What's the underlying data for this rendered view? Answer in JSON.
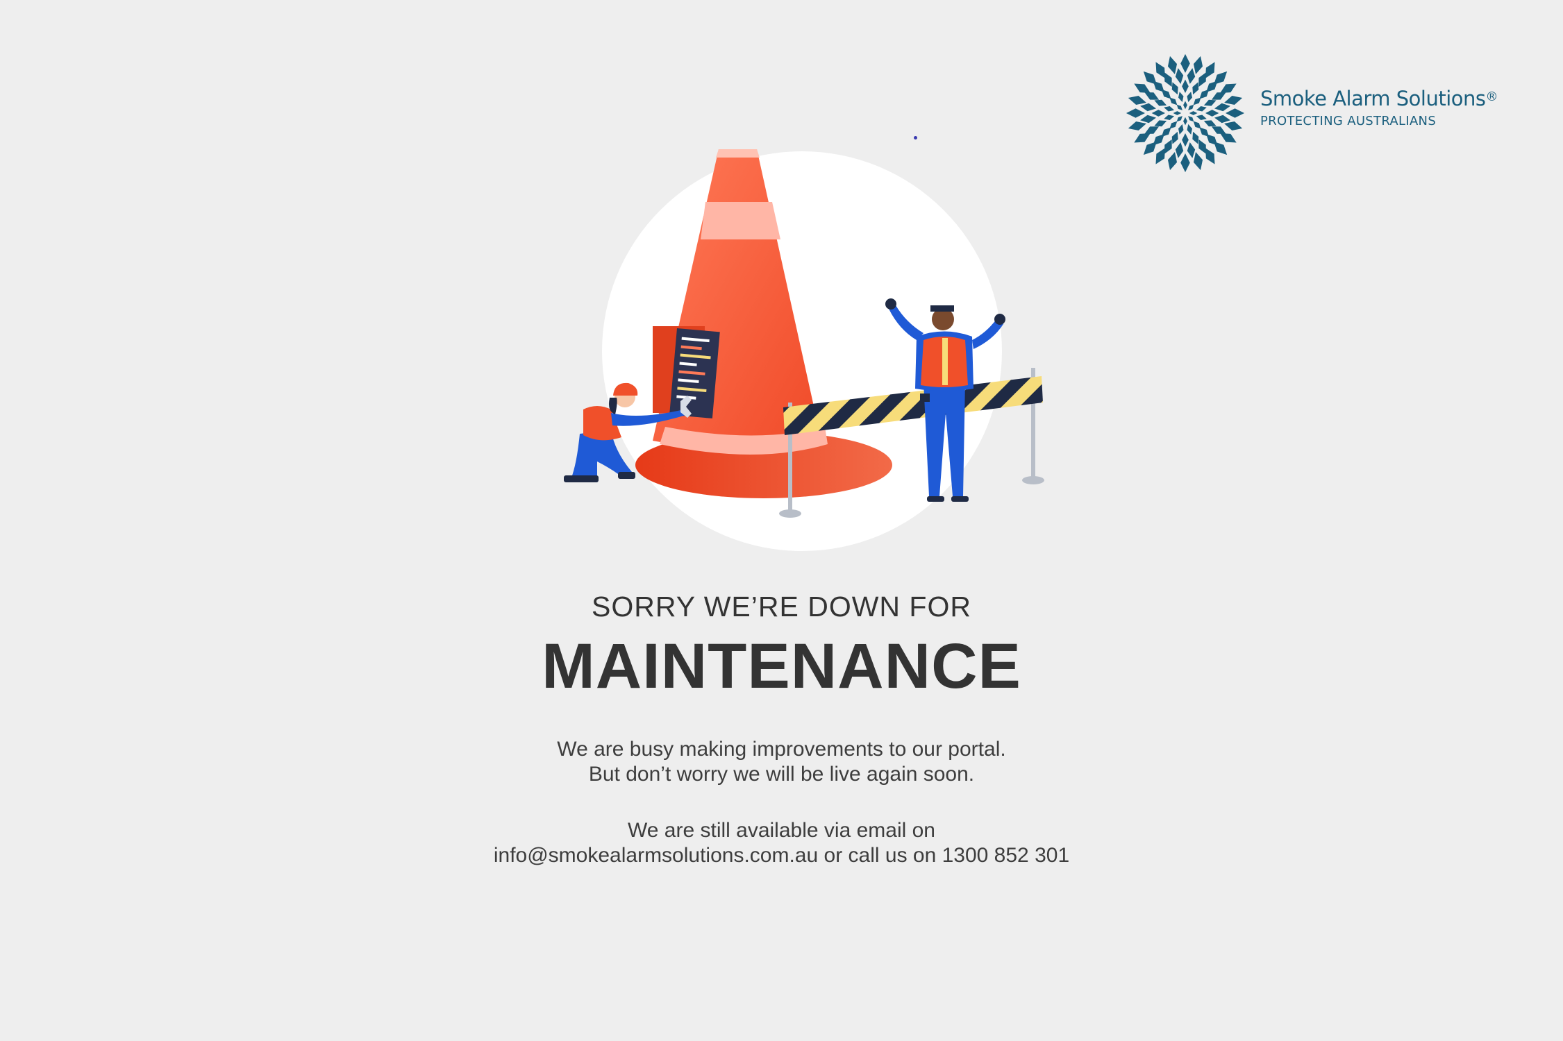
{
  "brand": {
    "name": "Smoke Alarm Solutions",
    "registered_mark": "®",
    "tagline": "PROTECTING AUSTRALIANS",
    "color": "#1b5f7e"
  },
  "icons": {
    "logo": "starburst-logo-icon",
    "illustration": "maintenance-cone-workers-illustration"
  },
  "heading": {
    "small": "SORRY WE’RE DOWN FOR",
    "big": "MAINTENANCE"
  },
  "message": {
    "line1": "We are busy making improvements to our portal.",
    "line2": "But don’t worry we will be live again soon."
  },
  "contact": {
    "line1": "We are still available via email on",
    "email": "info@smokealarmsolutions.com.au",
    "middle": " or call us on ",
    "phone": "1300 852 301"
  },
  "colors": {
    "background": "#eeeeee",
    "text": "#333333",
    "cone": "#f05a32"
  }
}
